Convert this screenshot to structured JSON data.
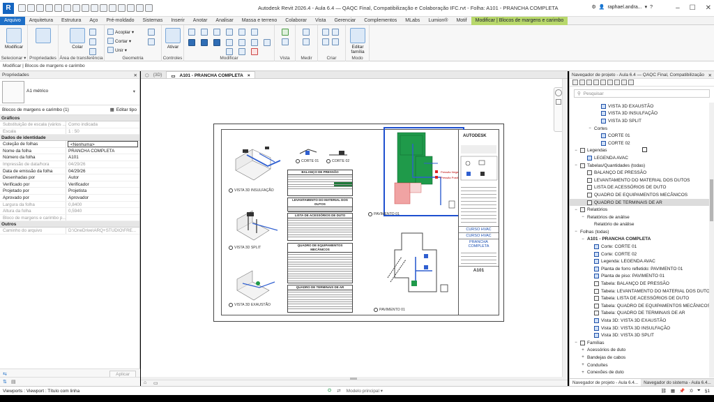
{
  "titlebar": {
    "title": "Autodesk Revit 2026.4 - Aula 6.4 — QAQC Final, Compatibilização e Colaboração IFC.rvt - Folha: A101 - PRANCHA COMPLETA",
    "user": "raphael.andra...",
    "logo_letter": "R"
  },
  "ribbon_tabs": [
    "Arquivo",
    "Arquitetura",
    "Estrutura",
    "Aço",
    "Pré-moldado",
    "Sistemas",
    "Inserir",
    "Anotar",
    "Analisar",
    "Massa e terreno",
    "Colaborar",
    "Vista",
    "Gerenciar",
    "Complementos",
    "MLabs",
    "Lumion®",
    "Motif",
    "Modificar | Blocos de margens e carimbo"
  ],
  "ribbon": {
    "modify": "Modificar",
    "select": "Selecionar ▾",
    "properties": "Propriedades",
    "clipboard": "Área de transferência",
    "paste": "Colar",
    "cope": "Acoplar ▾",
    "cut": "Cortar ▾",
    "join": "Unir ▾",
    "geometry": "Geometria",
    "activate": "Ativar",
    "controls": "Controles",
    "modify_group": "Modificar",
    "view": "Vista",
    "measure": "Medir",
    "create": "Criar",
    "edit_family": "Editar família",
    "mode": "Modo"
  },
  "optbar": "Modificar | Blocos de margens e carimbo",
  "properties": {
    "title": "Propriedades",
    "type_name": "A1 métrico",
    "instance": "Blocos de margens e carimbo (1)",
    "edit_type": "Editar tipo",
    "sections": [
      {
        "name": "Gráficos",
        "rows": [
          {
            "k": "Substituição de escala (vários ...",
            "v": "Como indicada",
            "dim": true
          },
          {
            "k": "Escala",
            "v": "1 : 50",
            "dim": true
          }
        ]
      },
      {
        "name": "Dados de identidade",
        "rows": [
          {
            "k": "Coleção de folhas",
            "v": "<Nenhuma>",
            "boxed": true
          },
          {
            "k": "Nome da folha",
            "v": "PRANCHA COMPLETA"
          },
          {
            "k": "Número da folha",
            "v": "A101"
          },
          {
            "k": "Impressão de data/hora",
            "v": "04/29/26",
            "dim": true
          },
          {
            "k": "Data de emissão da folha",
            "v": "04/29/26"
          },
          {
            "k": "Desenhadas por",
            "v": "Autor"
          },
          {
            "k": "Verificado por",
            "v": "Verificador"
          },
          {
            "k": "Projetado por",
            "v": "Projetista"
          },
          {
            "k": "Aprovado por",
            "v": "Aprovador"
          },
          {
            "k": "Largura da folha",
            "v": "0,8400",
            "dim": true
          },
          {
            "k": "Altura da folha",
            "v": "0,5940",
            "dim": true
          },
          {
            "k": "Bloco de margens e carimbo p...",
            "v": "",
            "dim": true
          }
        ]
      },
      {
        "name": "Outros",
        "rows": [
          {
            "k": "Caminho do arquivo",
            "v": "D:\\OneDrive\\ARQ+STUDIO\\FRE...",
            "dim": true
          }
        ]
      }
    ],
    "apply": "Aplicar"
  },
  "view_tabs": [
    {
      "label": "{3D}",
      "active": false
    },
    {
      "label": "A101 - PRANCHA COMPLETA",
      "active": true,
      "close": "×"
    }
  ],
  "sheet": {
    "brand": "AUTODESK",
    "course1": "CURSO HVAC",
    "course2": "CURSO HVAC",
    "sheet_name": "PRANCHA COMPLETA",
    "code": "A101",
    "viewports": {
      "insul": "VISTA 3D INSULFAÇÃO",
      "split": "VISTA 3D SPLIT",
      "exhaust": "VISTA 3D EXAUSTÃO",
      "corte1": "CORTE 01",
      "corte2": "CORTE 02",
      "pav1": "PAVIMENTO 01",
      "pav1b": "PAVIMENTO 01"
    },
    "schedules": {
      "balanco": "BALANÇO DE PRESSÃO",
      "levant": "LEVANTAMENTO DO MATERIAL DOS DUTOS",
      "acess": "LISTA DE ACESSÓRIOS DE DUTO",
      "equip": "QUADRO DE EQUIPAMENTOS MECÂNICOS",
      "term": "QUADRO DE TERMINAIS DE AR"
    },
    "legend1": "Pressão Negativa",
    "legend2": "Pressão Positiva"
  },
  "browser": {
    "title": "Navegador de projeto - Aula 6.4 — QAQC Final, Compatibilização e...",
    "search_placeholder": "Pesquisar",
    "items": [
      {
        "indent": 3,
        "icon": "view",
        "label": "VISTA 3D EXAUSTÃO"
      },
      {
        "indent": 3,
        "icon": "view",
        "label": "VISTA 3D INSULFAÇÃO"
      },
      {
        "indent": 3,
        "icon": "view",
        "label": "VISTA 3D SPLIT"
      },
      {
        "indent": 2,
        "exp": "−",
        "label": "Cortes"
      },
      {
        "indent": 3,
        "icon": "view",
        "label": "CORTE 01"
      },
      {
        "indent": 3,
        "icon": "view",
        "label": "CORTE 02"
      },
      {
        "indent": 0,
        "exp": "−",
        "icon": "plain",
        "label": "Legendas"
      },
      {
        "indent": 1,
        "icon": "view",
        "label": "LEGENDA AVAC"
      },
      {
        "indent": 0,
        "exp": "−",
        "icon": "plain",
        "label": "Tabelas/Quantidades (todas)"
      },
      {
        "indent": 1,
        "icon": "plain",
        "label": "BALANÇO DE PRESSÃO"
      },
      {
        "indent": 1,
        "icon": "plain",
        "label": "LEVANTAMENTO DO MATERIAL DOS DUTOS"
      },
      {
        "indent": 1,
        "icon": "plain",
        "label": "LISTA DE ACESSÓRIOS DE DUTO"
      },
      {
        "indent": 1,
        "icon": "plain",
        "label": "QUADRO DE EQUIPAMENTOS MECÂNICOS"
      },
      {
        "indent": 1,
        "icon": "plain",
        "label": "QUADRO DE TERMINAIS DE AR",
        "hl": true
      },
      {
        "indent": 0,
        "exp": "−",
        "icon": "plain",
        "label": "Relatórios"
      },
      {
        "indent": 1,
        "exp": "−",
        "label": "Relatórios de análise"
      },
      {
        "indent": 2,
        "label": "Relatório de análise"
      },
      {
        "indent": 0,
        "exp": "−",
        "icon": "sheet",
        "label": "Folhas (todas)"
      },
      {
        "indent": 1,
        "exp": "−",
        "label": "A101 - PRANCHA COMPLETA",
        "bold": true
      },
      {
        "indent": 2,
        "icon": "view",
        "label": "Corte: CORTE 01"
      },
      {
        "indent": 2,
        "icon": "view",
        "label": "Corte: CORTE 02"
      },
      {
        "indent": 2,
        "icon": "view",
        "label": "Legenda: LEGENDA AVAC"
      },
      {
        "indent": 2,
        "icon": "view",
        "label": "Planta de forro refletido: PAVIMENTO 01"
      },
      {
        "indent": 2,
        "icon": "view",
        "label": "Planta de piso: PAVIMENTO 01"
      },
      {
        "indent": 2,
        "icon": "plain",
        "label": "Tabela: BALANÇO DE PRESSÃO"
      },
      {
        "indent": 2,
        "icon": "plain",
        "label": "Tabela: LEVANTAMENTO DO MATERIAL DOS DUTOS"
      },
      {
        "indent": 2,
        "icon": "plain",
        "label": "Tabela: LISTA DE ACESSÓRIOS DE DUTO"
      },
      {
        "indent": 2,
        "icon": "plain",
        "label": "Tabela: QUADRO DE EQUIPAMENTOS MECÂNICOS"
      },
      {
        "indent": 2,
        "icon": "plain",
        "label": "Tabela: QUADRO DE TERMINAIS DE AR"
      },
      {
        "indent": 2,
        "icon": "view",
        "label": "Vista 3D: VISTA 3D EXAUSTÃO"
      },
      {
        "indent": 2,
        "icon": "view",
        "label": "Vista 3D: VISTA 3D INSULFAÇÃO"
      },
      {
        "indent": 2,
        "icon": "view",
        "label": "Vista 3D: VISTA 3D SPLIT"
      },
      {
        "indent": 0,
        "exp": "−",
        "icon": "plain",
        "label": "Famílias"
      },
      {
        "indent": 1,
        "exp": "+",
        "label": "Acessórios de duto"
      },
      {
        "indent": 1,
        "exp": "+",
        "label": "Bandejas de cabos"
      },
      {
        "indent": 1,
        "exp": "+",
        "label": "Conduítes"
      },
      {
        "indent": 1,
        "exp": "+",
        "label": "Conexões de duto"
      }
    ],
    "tab1": "Navegador de projeto - Aula 6.4...",
    "tab2": "Navegador do sistema - Aula 6.4..."
  },
  "status": {
    "left": "Viewports : Viewport : Título com linha",
    "model": "Modelo principal",
    "count": ":0",
    "filter": "§1"
  },
  "colors": {
    "accent": "#1e6fc7",
    "context_tab": "#b8d86b",
    "duct_blue": "#2f5fd0",
    "zone_green": "#1f9a4a",
    "zone_red": "#e07a7a"
  }
}
